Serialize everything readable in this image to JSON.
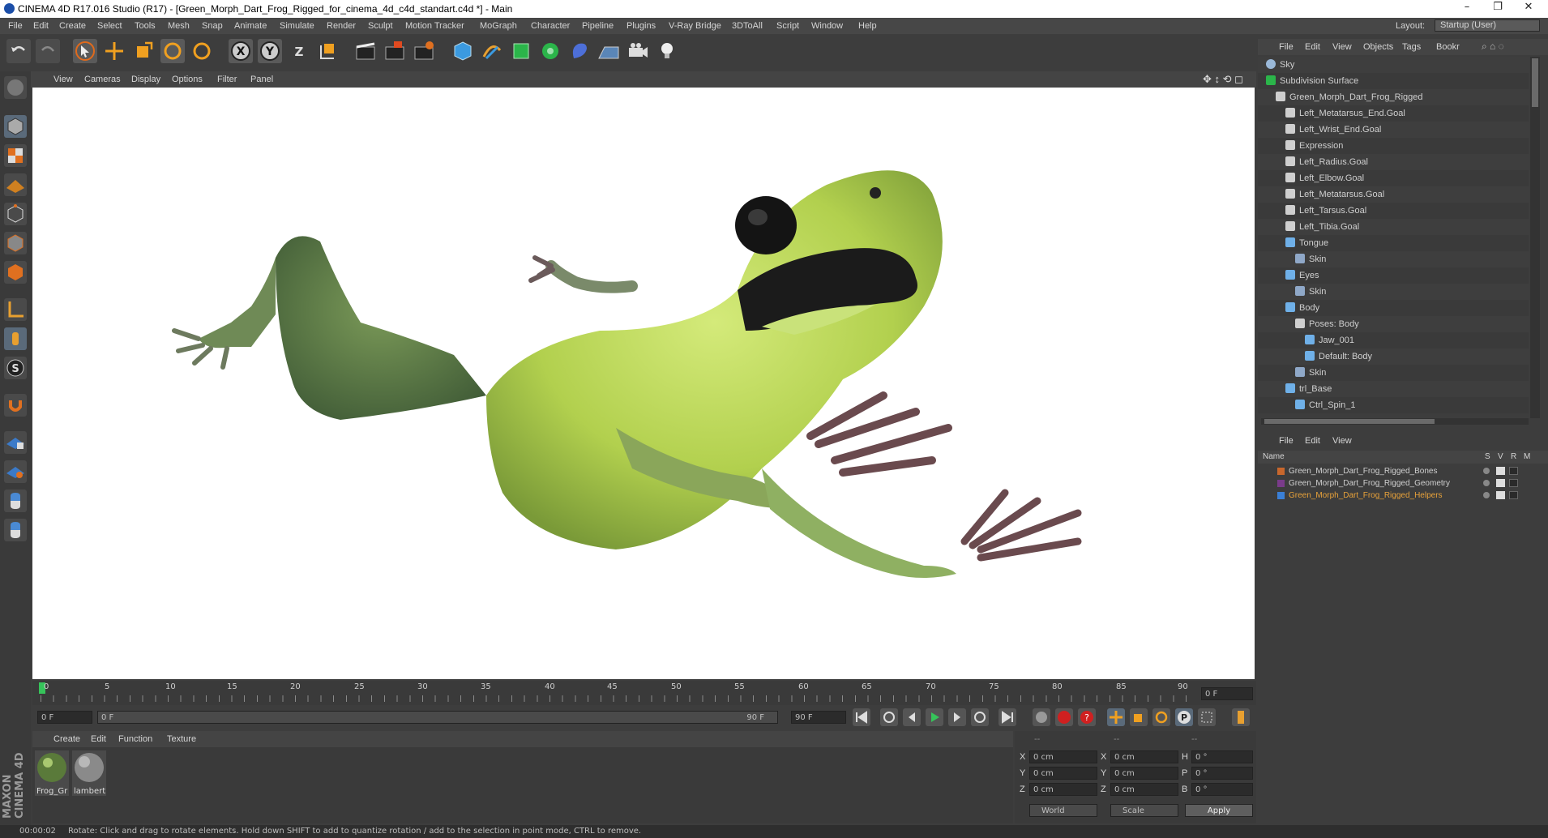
{
  "title": "CINEMA 4D R17.016 Studio (R17) - [Green_Morph_Dart_Frog_Rigged_for_cinema_4d_c4d_standart.c4d *] - Main",
  "window_controls": [
    "–",
    "❐",
    "✕"
  ],
  "menu": [
    "File",
    "Edit",
    "Create",
    "Select",
    "Tools",
    "Mesh",
    "Snap",
    "Animate",
    "Simulate",
    "Render",
    "Sculpt",
    "Motion Tracker",
    "MoGraph",
    "Character",
    "Pipeline",
    "Plugins",
    "V-Ray Bridge",
    "3DToAll",
    "Script",
    "Window",
    "Help"
  ],
  "layout": {
    "label": "Layout:",
    "value": "Startup (User)"
  },
  "toolbar_labels": {
    "x": "X",
    "y": "Y",
    "z": "Z"
  },
  "viewport_menu": [
    "View",
    "Cameras",
    "Display",
    "Options",
    "Filter",
    "Panel"
  ],
  "timeline": {
    "ticks": [
      "0",
      "5",
      "10",
      "15",
      "20",
      "25",
      "30",
      "35",
      "40",
      "45",
      "50",
      "55",
      "60",
      "65",
      "70",
      "75",
      "80",
      "85",
      "90"
    ],
    "current_frame": "0 F",
    "start_field": "0 F",
    "range_start": "0 F",
    "range_end": "90 F",
    "end_field": "90 F"
  },
  "material_menu": [
    "Create",
    "Edit",
    "Function",
    "Texture"
  ],
  "materials": [
    {
      "name": "Frog_Gr"
    },
    {
      "name": "lambert"
    }
  ],
  "brand": "MAXON CINEMA 4D",
  "coords": {
    "headers": [
      "--",
      "--",
      "--"
    ],
    "rows": [
      {
        "a": "X",
        "av": "0 cm",
        "b": "X",
        "bv": "0 cm",
        "c": "H",
        "cv": "0 °"
      },
      {
        "a": "Y",
        "av": "0 cm",
        "b": "Y",
        "bv": "0 cm",
        "c": "P",
        "cv": "0 °"
      },
      {
        "a": "Z",
        "av": "0 cm",
        "b": "Z",
        "bv": "0 cm",
        "c": "B",
        "cv": "0 °"
      }
    ],
    "world": "World",
    "scale": "Scale",
    "apply": "Apply"
  },
  "object_menu": [
    "File",
    "Edit",
    "View",
    "Objects",
    "Tags",
    "Bookr"
  ],
  "objects": [
    {
      "name": "Sky",
      "icon": "sky-icon",
      "indent": 0
    },
    {
      "name": "Subdivision Surface",
      "icon": "subdivision-icon",
      "indent": 0
    },
    {
      "name": "Green_Morph_Dart_Frog_Rigged",
      "icon": "null-icon",
      "indent": 1
    },
    {
      "name": "Left_Metatarsus_End.Goal",
      "icon": "null-icon",
      "indent": 2
    },
    {
      "name": "Left_Wrist_End.Goal",
      "icon": "null-icon",
      "indent": 2
    },
    {
      "name": "Expression",
      "icon": "null-icon",
      "indent": 2
    },
    {
      "name": "Left_Radius.Goal",
      "icon": "null-icon",
      "indent": 2
    },
    {
      "name": "Left_Elbow.Goal",
      "icon": "null-icon",
      "indent": 2
    },
    {
      "name": "Left_Metatarsus.Goal",
      "icon": "null-icon",
      "indent": 2
    },
    {
      "name": "Left_Tarsus.Goal",
      "icon": "null-icon",
      "indent": 2
    },
    {
      "name": "Left_Tibia.Goal",
      "icon": "null-icon",
      "indent": 2
    },
    {
      "name": "Tongue",
      "icon": "joint-icon",
      "indent": 2
    },
    {
      "name": "Skin",
      "icon": "skin-icon",
      "indent": 3
    },
    {
      "name": "Eyes",
      "icon": "joint-icon",
      "indent": 2
    },
    {
      "name": "Skin",
      "icon": "skin-icon",
      "indent": 3
    },
    {
      "name": "Body",
      "icon": "joint-icon",
      "indent": 2
    },
    {
      "name": "Poses: Body",
      "icon": "null-icon",
      "indent": 3
    },
    {
      "name": "Jaw_001",
      "icon": "joint-icon",
      "indent": 4
    },
    {
      "name": "Default: Body",
      "icon": "joint-icon",
      "indent": 4
    },
    {
      "name": "Skin",
      "icon": "skin-icon",
      "indent": 3
    },
    {
      "name": "trl_Base",
      "icon": "joint-icon",
      "indent": 2
    },
    {
      "name": "Ctrl_Spin_1",
      "icon": "joint-icon",
      "indent": 3
    }
  ],
  "layer_menu": [
    "File",
    "Edit",
    "View"
  ],
  "layer_headers": {
    "name": "Name",
    "s": "S",
    "v": "V",
    "r": "R",
    "m": "M"
  },
  "layers": [
    {
      "name": "Green_Morph_Dart_Frog_Rigged_Bones",
      "color": "#c8672c",
      "text_color": "#d0d0d0"
    },
    {
      "name": "Green_Morph_Dart_Frog_Rigged_Geometry",
      "color": "#7a3b8a",
      "text_color": "#d0d0d0"
    },
    {
      "name": "Green_Morph_Dart_Frog_Rigged_Helpers",
      "color": "#3a7fd6",
      "text_color": "#e8a23a"
    }
  ],
  "status": {
    "time": "00:00:02",
    "message": "Rotate: Click and drag to rotate elements. Hold down SHIFT to add to quantize rotation / add to the selection in point mode, CTRL to remove."
  }
}
